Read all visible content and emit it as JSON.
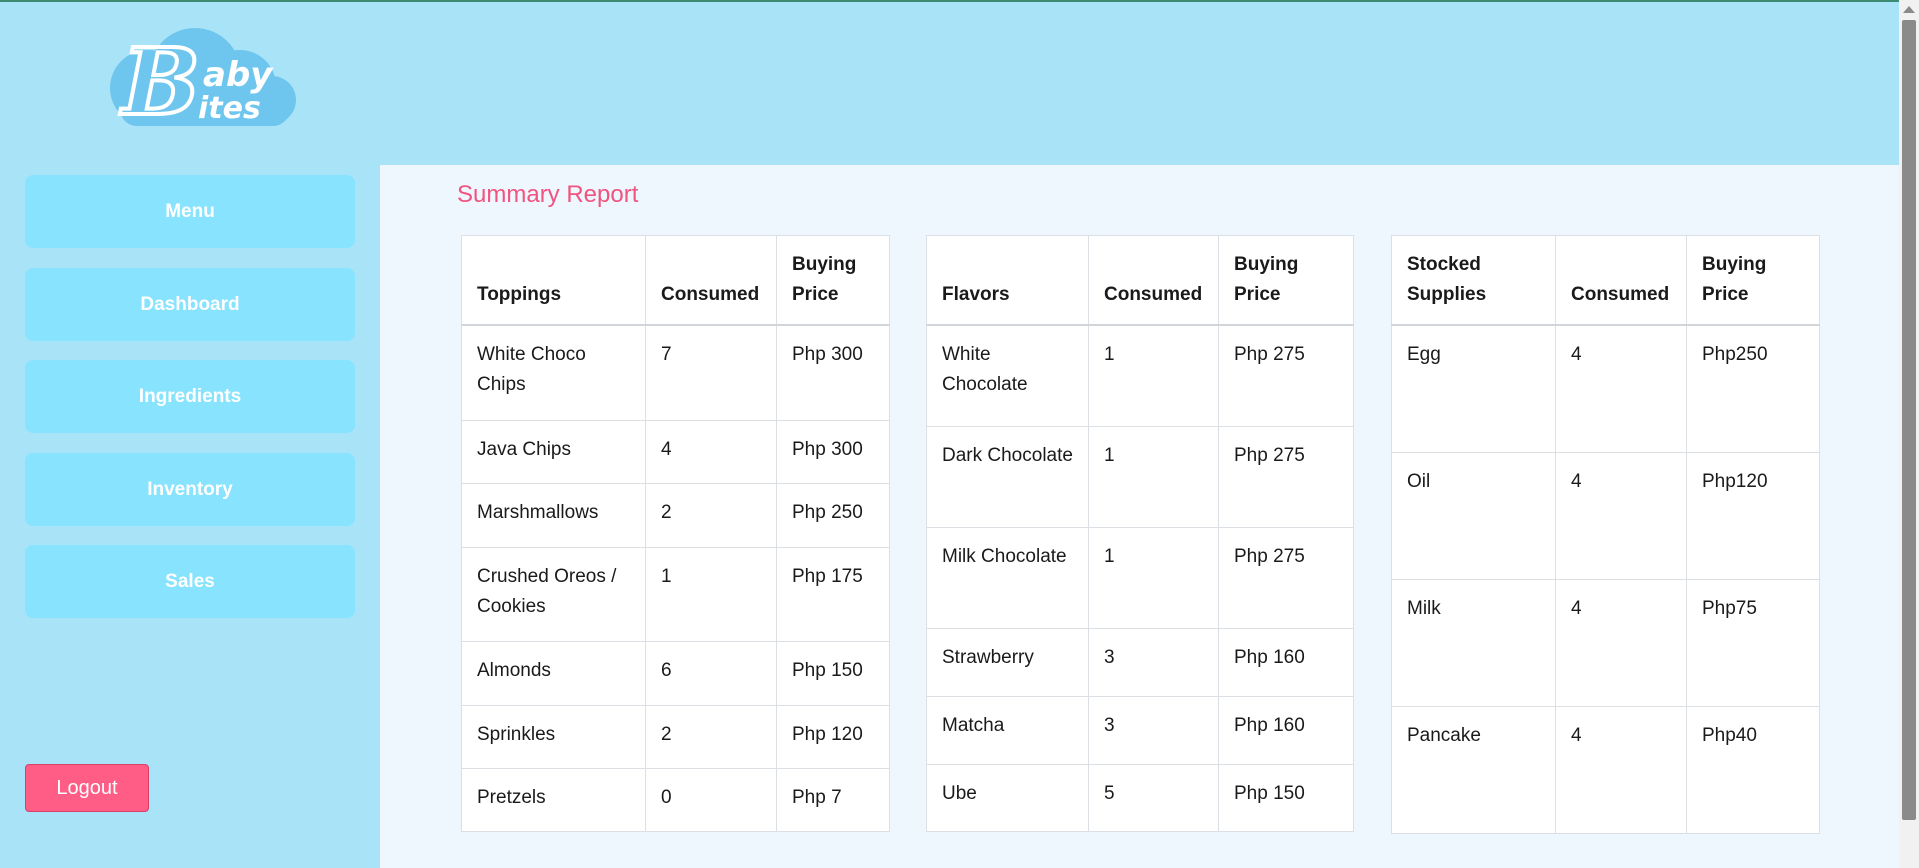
{
  "brand": {
    "logo_text_top": "aby",
    "logo_text_bottom": "ites",
    "logo_letter": "B"
  },
  "nav": {
    "items": [
      {
        "label": "Menu"
      },
      {
        "label": "Dashboard"
      },
      {
        "label": "Ingredients"
      },
      {
        "label": "Inventory"
      },
      {
        "label": "Sales"
      }
    ],
    "logout_label": "Logout"
  },
  "page": {
    "title": "Summary Report"
  },
  "toppings": {
    "headers": [
      "Toppings",
      "Consumed",
      "Buying Price"
    ],
    "rows": [
      [
        "White Choco Chips",
        "7",
        "Php 300"
      ],
      [
        "Java Chips",
        "4",
        "Php 300"
      ],
      [
        "Marshmallows",
        "2",
        "Php 250"
      ],
      [
        "Crushed Oreos / Cookies",
        "1",
        "Php 175"
      ],
      [
        "Almonds",
        "6",
        "Php 150"
      ],
      [
        "Sprinkles",
        "2",
        "Php 120"
      ],
      [
        "Pretzels",
        "0",
        "Php 7"
      ]
    ]
  },
  "flavors": {
    "headers": [
      "Flavors",
      "Consumed",
      "Buying Price"
    ],
    "rows": [
      [
        "White Chocolate",
        "1",
        "Php 275"
      ],
      [
        "Dark Chocolate",
        "1",
        "Php 275"
      ],
      [
        "Milk Chocolate",
        "1",
        "Php 275"
      ],
      [
        "Strawberry",
        "3",
        "Php 160"
      ],
      [
        "Matcha",
        "3",
        "Php 160"
      ],
      [
        "Ube",
        "5",
        "Php 150"
      ]
    ]
  },
  "supplies": {
    "headers": [
      "Stocked Supplies",
      "Consumed",
      "Buying Price"
    ],
    "rows": [
      [
        "Egg",
        "4",
        "Php250"
      ],
      [
        "Oil",
        "4",
        "Php120"
      ],
      [
        "Milk",
        "4",
        "Php75"
      ],
      [
        "Pancake",
        "4",
        "Php40"
      ]
    ]
  },
  "colors": {
    "accent": "#f0547f",
    "nav_button": "#88e3fe",
    "background": "#a9e3f8",
    "logout": "#ff5c86"
  }
}
